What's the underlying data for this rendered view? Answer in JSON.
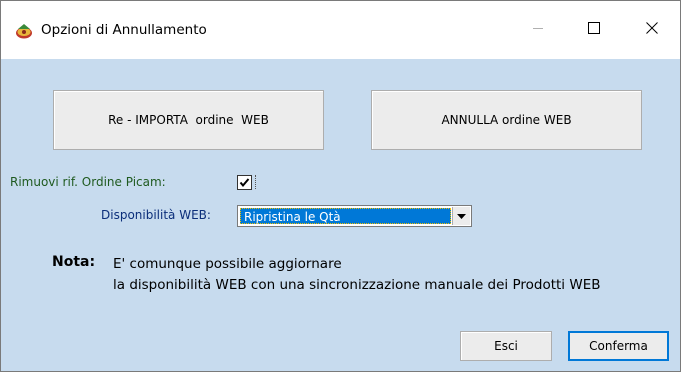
{
  "window": {
    "title": "Opzioni di Annullamento"
  },
  "icons": {
    "app": "app-logo-icon",
    "minimize": "minimize-icon",
    "maximize": "maximize-icon",
    "close": "close-icon",
    "check": "checkmark-icon",
    "dropdown": "chevron-down-icon"
  },
  "colors": {
    "client_background": "#c7dbee",
    "label_green": "#1f5a1f",
    "label_blue": "#0b2e7a",
    "selection": "#0078d7"
  },
  "buttons": {
    "reimport_label": "Re - IMPORTA  ordine  WEB",
    "annulla_label": "ANNULLA ordine WEB",
    "esci_label": "Esci",
    "conferma_label": "Conferma"
  },
  "form": {
    "remove_ref_label": "Rimuovi rif. Ordine Picam:",
    "remove_ref_checked": true,
    "availability_label": "Disponibilità WEB:",
    "availability_value": "Ripristina le Qtà"
  },
  "note": {
    "label": "Nota:",
    "line1": "E' comunque possibile aggiornare",
    "line2": "la disponibilità WEB con una sincronizzazione manuale dei Prodotti WEB"
  }
}
